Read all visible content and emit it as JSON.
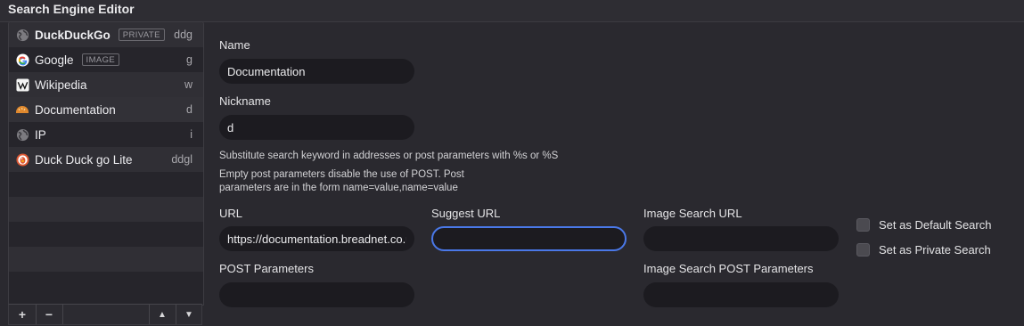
{
  "window": {
    "title": "Search Engine Editor"
  },
  "sidebar": {
    "engines": [
      {
        "name": "DuckDuckGo",
        "badge": "PRIVATE",
        "keyword": "ddg",
        "icon": "globe-icon",
        "bold": true
      },
      {
        "name": "Google",
        "badge": "IMAGE",
        "keyword": "g",
        "icon": "google-icon",
        "bold": false
      },
      {
        "name": "Wikipedia",
        "badge": "",
        "keyword": "w",
        "icon": "wikipedia-icon",
        "bold": false
      },
      {
        "name": "Documentation",
        "badge": "",
        "keyword": "d",
        "icon": "bread-icon",
        "bold": false
      },
      {
        "name": "IP",
        "badge": "",
        "keyword": "i",
        "icon": "globe-icon",
        "bold": false
      },
      {
        "name": "Duck Duck go Lite",
        "badge": "",
        "keyword": "ddgl",
        "icon": "duckduckgo-icon",
        "bold": false
      }
    ],
    "selected_index": 3,
    "footer": {
      "add": "+",
      "remove": "−",
      "move_up": "▲",
      "move_down": "▼"
    }
  },
  "form": {
    "name_label": "Name",
    "name_value": "Documentation",
    "nickname_label": "Nickname",
    "nickname_value": "d",
    "help_keyword": "Substitute search keyword in addresses or post parameters with %s or %S",
    "help_post_line1": "Empty post parameters disable the use of POST. Post",
    "help_post_line2": "parameters are in the form name=value,name=value",
    "url_label": "URL",
    "url_value": "https://documentation.breadnet.co.uk/?q=%s",
    "suggest_label": "Suggest URL",
    "suggest_value": "",
    "image_search_label": "Image Search URL",
    "image_search_value": "",
    "post_label": "POST Parameters",
    "post_value": "",
    "image_post_label": "Image Search POST Parameters",
    "image_post_value": "",
    "default_search_label": "Set as Default Search",
    "default_search_checked": false,
    "private_search_label": "Set as Private Search",
    "private_search_checked": false
  },
  "colors": {
    "accent": "#4a78e8",
    "background": "#2b2a30",
    "field": "#1c1b20"
  }
}
